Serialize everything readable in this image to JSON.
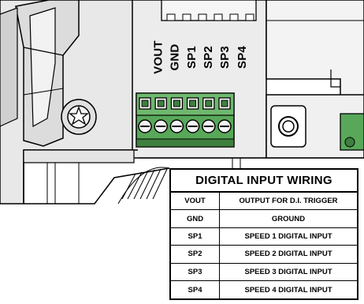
{
  "terminal": {
    "pins": [
      "VOUT",
      "GND",
      "SP1",
      "SP2",
      "SP3",
      "SP4"
    ]
  },
  "table": {
    "title": "DIGITAL INPUT WIRING",
    "rows": [
      {
        "signal": "VOUT",
        "description": "OUTPUT FOR D.I. TRIGGER"
      },
      {
        "signal": "GND",
        "description": "GROUND"
      },
      {
        "signal": "SP1",
        "description": "SPEED 1 DIGITAL INPUT"
      },
      {
        "signal": "SP2",
        "description": "SPEED 2 DIGITAL INPUT"
      },
      {
        "signal": "SP3",
        "description": "SPEED 3 DIGITAL INPUT"
      },
      {
        "signal": "SP4",
        "description": "SPEED 4 DIGITAL INPUT"
      }
    ]
  },
  "colors": {
    "terminal_green": "#59a85a",
    "terminal_dark_green": "#3f7f3f",
    "panel_gray": "#e6e6e6",
    "line": "#000000"
  }
}
